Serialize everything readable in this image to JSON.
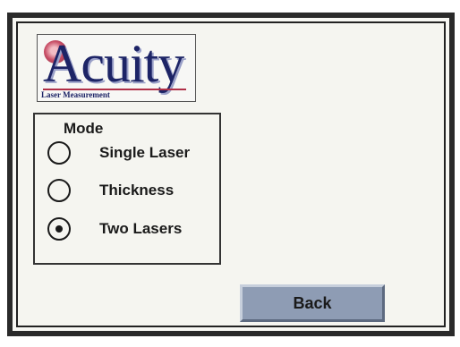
{
  "logo": {
    "word": "Acuity",
    "tagline": "Laser Measurement"
  },
  "mode": {
    "title": "Mode",
    "options": [
      {
        "label": "Single Laser",
        "selected": false
      },
      {
        "label": "Thickness",
        "selected": false
      },
      {
        "label": "Two Lasers",
        "selected": true
      }
    ]
  },
  "actions": {
    "back_label": "Back"
  },
  "colors": {
    "button_fill": "#8e9cb4",
    "logo_text": "#1d2466",
    "logo_accent": "#b03048"
  }
}
